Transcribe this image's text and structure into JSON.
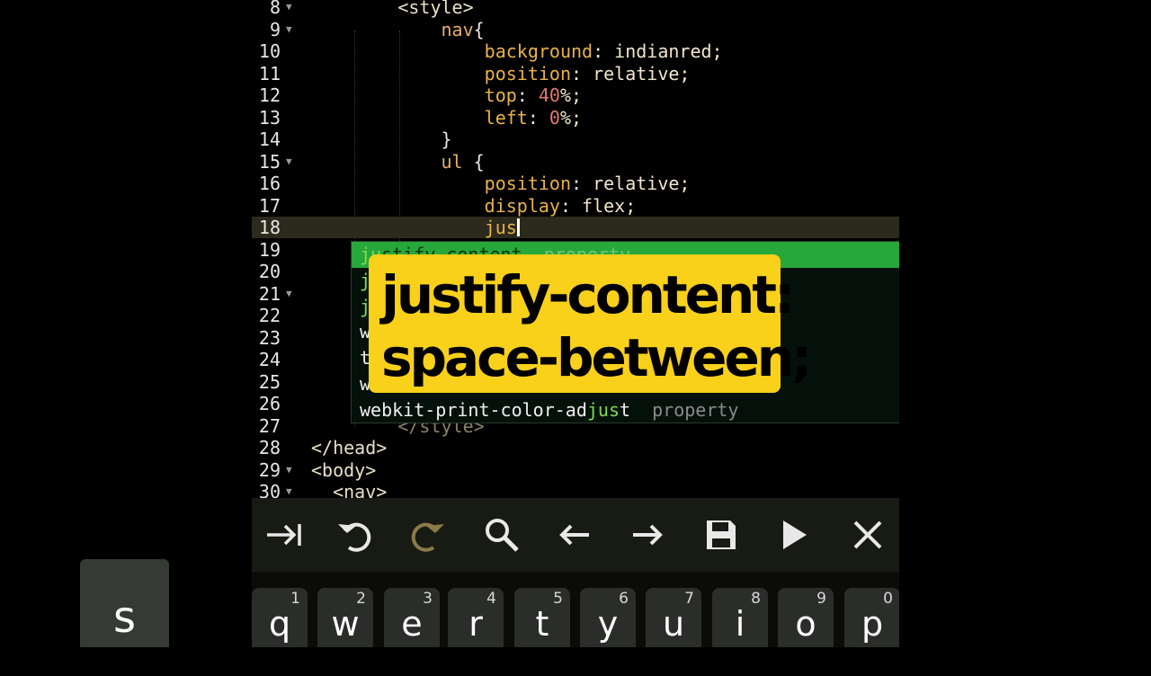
{
  "editor": {
    "lines": [
      {
        "n": "8",
        "fold": true,
        "tokens": [
          {
            "t": "        ",
            "c": ""
          },
          {
            "t": "<style>",
            "c": "t-tag"
          }
        ]
      },
      {
        "n": "9",
        "fold": true,
        "tokens": [
          {
            "t": "            ",
            "c": ""
          },
          {
            "t": "nav",
            "c": "t-sel"
          },
          {
            "t": "{",
            "c": "t-brace"
          }
        ]
      },
      {
        "n": "10",
        "fold": false,
        "tokens": [
          {
            "t": "                ",
            "c": ""
          },
          {
            "t": "background",
            "c": "t-prop"
          },
          {
            "t": ": indianred;",
            "c": "t-val"
          }
        ]
      },
      {
        "n": "11",
        "fold": false,
        "tokens": [
          {
            "t": "                ",
            "c": ""
          },
          {
            "t": "position",
            "c": "t-prop"
          },
          {
            "t": ": relative;",
            "c": "t-val"
          }
        ]
      },
      {
        "n": "12",
        "fold": false,
        "tokens": [
          {
            "t": "                ",
            "c": ""
          },
          {
            "t": "top",
            "c": "t-prop"
          },
          {
            "t": ": ",
            "c": "t-val"
          },
          {
            "t": "40",
            "c": "t-num"
          },
          {
            "t": "%;",
            "c": "t-val"
          }
        ]
      },
      {
        "n": "13",
        "fold": false,
        "tokens": [
          {
            "t": "                ",
            "c": ""
          },
          {
            "t": "left",
            "c": "t-prop"
          },
          {
            "t": ": ",
            "c": "t-val"
          },
          {
            "t": "0",
            "c": "t-num"
          },
          {
            "t": "%;",
            "c": "t-val"
          }
        ]
      },
      {
        "n": "14",
        "fold": false,
        "tokens": [
          {
            "t": "            ",
            "c": ""
          },
          {
            "t": "}",
            "c": "t-brace"
          }
        ]
      },
      {
        "n": "15",
        "fold": true,
        "tokens": [
          {
            "t": "            ",
            "c": ""
          },
          {
            "t": "ul",
            "c": "t-sel"
          },
          {
            "t": " {",
            "c": "t-brace"
          }
        ]
      },
      {
        "n": "16",
        "fold": false,
        "tokens": [
          {
            "t": "                ",
            "c": ""
          },
          {
            "t": "position",
            "c": "t-prop"
          },
          {
            "t": ": relative;",
            "c": "t-val"
          }
        ]
      },
      {
        "n": "17",
        "fold": false,
        "tokens": [
          {
            "t": "                ",
            "c": ""
          },
          {
            "t": "display",
            "c": "t-prop"
          },
          {
            "t": ": flex;",
            "c": "t-val"
          }
        ]
      },
      {
        "n": "18",
        "fold": false,
        "current": true,
        "tokens": [
          {
            "t": "                ",
            "c": ""
          },
          {
            "t": "jus",
            "c": "t-prop"
          }
        ]
      },
      {
        "n": "19",
        "fold": false,
        "tokens": []
      },
      {
        "n": "20",
        "fold": false,
        "tokens": []
      },
      {
        "n": "21",
        "fold": true,
        "tokens": []
      },
      {
        "n": "22",
        "fold": false,
        "tokens": []
      },
      {
        "n": "23",
        "fold": false,
        "tokens": []
      },
      {
        "n": "24",
        "fold": false,
        "tokens": []
      },
      {
        "n": "25",
        "fold": false,
        "tokens": []
      },
      {
        "n": "26",
        "fold": false,
        "tokens": []
      },
      {
        "n": "27",
        "fold": false,
        "tokens": [
          {
            "t": "        ",
            "c": ""
          },
          {
            "t": "</style>",
            "c": "t-dim"
          }
        ]
      },
      {
        "n": "28",
        "fold": false,
        "tokens": [
          {
            "t": "</head>",
            "c": "t-tag"
          }
        ]
      },
      {
        "n": "29",
        "fold": true,
        "tokens": [
          {
            "t": "<body>",
            "c": "t-tag"
          }
        ]
      },
      {
        "n": "30",
        "fold": true,
        "tokens": [
          {
            "t": "  ",
            "c": ""
          },
          {
            "t": "<nav>",
            "c": "t-tag"
          }
        ]
      }
    ]
  },
  "autocomplete": {
    "items": [
      {
        "pre": "",
        "match": "ju",
        "post": "stify-content",
        "kind": "property",
        "selected": true
      },
      {
        "pre": "",
        "match": "j",
        "post": "",
        "kind": "",
        "selected": false
      },
      {
        "pre": "",
        "match": "j",
        "post": "",
        "kind": "",
        "selected": false
      },
      {
        "pre": "w",
        "match": "",
        "post": "",
        "kind": "",
        "selected": false
      },
      {
        "pre": "t",
        "match": "",
        "post": "",
        "kind": "",
        "selected": false
      },
      {
        "pre": "w",
        "match": "",
        "post": "",
        "kind": "",
        "selected": false
      },
      {
        "pre": "webkit-print-color-ad",
        "match": "jus",
        "post": "t",
        "kind": "property",
        "selected": false
      }
    ]
  },
  "overlay": {
    "line1": "justify-content:",
    "line2": "space-between;"
  },
  "toolbar": {
    "tools": [
      {
        "name": "tab-icon",
        "color": "#e8e8e8"
      },
      {
        "name": "undo-icon",
        "color": "#e8e8e8"
      },
      {
        "name": "redo-icon",
        "color": "#8a7a4a"
      },
      {
        "name": "search-icon",
        "color": "#e8e8e8"
      },
      {
        "name": "arrow-left-icon",
        "color": "#e8e8e8"
      },
      {
        "name": "arrow-right-icon",
        "color": "#e8e8e8"
      },
      {
        "name": "save-icon",
        "color": "#e8e8e8"
      },
      {
        "name": "run-icon",
        "color": "#e8e8e8"
      },
      {
        "name": "close-icon",
        "color": "#e8e8e8"
      }
    ]
  },
  "keyboard": {
    "keys": [
      {
        "ch": "q",
        "hint": "1"
      },
      {
        "ch": "w",
        "hint": "2"
      },
      {
        "ch": "e",
        "hint": "3"
      },
      {
        "ch": "r",
        "hint": "4"
      },
      {
        "ch": "t",
        "hint": "5"
      },
      {
        "ch": "y",
        "hint": "6"
      },
      {
        "ch": "u",
        "hint": "7"
      },
      {
        "ch": "i",
        "hint": "8"
      },
      {
        "ch": "o",
        "hint": "9"
      },
      {
        "ch": "p",
        "hint": "0"
      }
    ],
    "popup": "s"
  }
}
